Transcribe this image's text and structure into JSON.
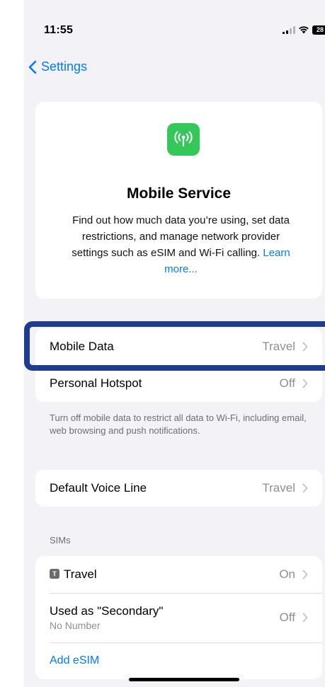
{
  "status": {
    "time": "11:55",
    "battery": "28"
  },
  "nav": {
    "back_label": "Settings"
  },
  "hero": {
    "title": "Mobile Service",
    "description": "Find out how much data you’re using, set data restrictions, and manage network provider settings such as eSIM and Wi-Fi calling.",
    "link": "Learn more..."
  },
  "data_group": {
    "rows": [
      {
        "label": "Mobile Data",
        "value": "Travel"
      },
      {
        "label": "Personal Hotspot",
        "value": "Off"
      }
    ],
    "footer": "Turn off mobile data to restrict all data to Wi-Fi, including email, web browsing and push notifications."
  },
  "voice_group": {
    "rows": [
      {
        "label": "Default Voice Line",
        "value": "Travel"
      }
    ]
  },
  "sims_group": {
    "header": "SIMs",
    "badge": "T",
    "rows": [
      {
        "label": "Travel",
        "value": "On"
      },
      {
        "label": "Used as \"Secondary\"",
        "sublabel": "No Number",
        "value": "Off"
      }
    ],
    "add_label": "Add eSIM"
  },
  "colors": {
    "accent": "#007aff",
    "icon_green": "#34c759",
    "highlight": "#1f3d8c"
  },
  "icons": [
    "back-chevron-icon",
    "signal-icon",
    "wifi-icon",
    "battery-icon",
    "antenna-icon",
    "chevron-right-icon",
    "sim-icon"
  ]
}
